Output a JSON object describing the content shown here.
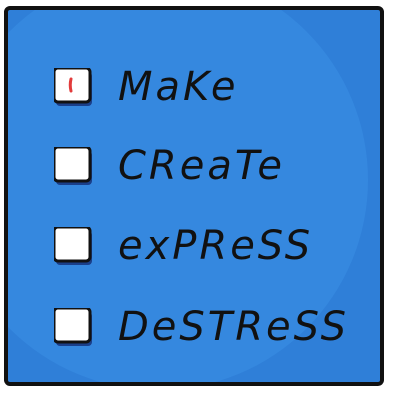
{
  "list": {
    "items": [
      {
        "label": "MaKe",
        "checked": true
      },
      {
        "label": "CReaTe",
        "checked": false
      },
      {
        "label": "exPReSS",
        "checked": false
      },
      {
        "label": "DeSTReSS",
        "checked": false
      }
    ]
  },
  "colors": {
    "board": "#2f7fd8",
    "outline": "#111111",
    "checkbox_fill": "#ffffff",
    "checkbox_shadow": "#1a3f8a",
    "check_mark": "#e23b3b"
  }
}
